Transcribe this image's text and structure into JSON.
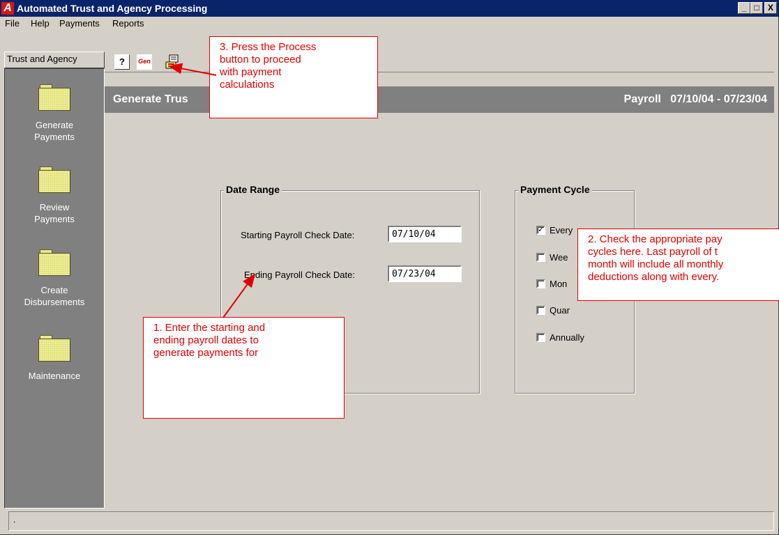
{
  "window": {
    "title": "Automated Trust and Agency Processing",
    "icon_letter": "A",
    "controls": {
      "minimize": "_",
      "maximize": "□",
      "close": "X"
    }
  },
  "menu": [
    "File",
    "Help",
    "Payments",
    "Reports"
  ],
  "sidebar": {
    "tab_label": "Trust and Agency",
    "items": [
      {
        "label_line1": "Generate",
        "label_line2": "Payments",
        "icon": "folder-icon"
      },
      {
        "label_line1": "Review",
        "label_line2": "Payments",
        "icon": "folder-icon"
      },
      {
        "label_line1": "Create",
        "label_line2": "Disbursements",
        "icon": "folder-icon"
      },
      {
        "label_line1": "Maintenance",
        "label_line2": "",
        "icon": "folder-icon"
      }
    ]
  },
  "toolbar": {
    "help_glyph": "?",
    "process_glyph": "Gen",
    "icons": [
      "help-icon",
      "process-icon",
      "report-icon"
    ]
  },
  "header": {
    "title": "Generate Trus",
    "payroll_label": "Payroll",
    "payroll_range": "07/10/04 - 07/23/04"
  },
  "date_range": {
    "title": "Date Range",
    "start_label": "Starting Payroll Check Date:",
    "start_value": "07/10/04",
    "end_label": "Ending Payroll Check Date:",
    "end_value": "07/23/04"
  },
  "payment_cycle": {
    "title": "Payment Cycle",
    "options": [
      {
        "label": "Every",
        "checked": true
      },
      {
        "label": "Wee",
        "checked": false
      },
      {
        "label": "Mon",
        "checked": false
      },
      {
        "label": "Quar",
        "checked": false
      },
      {
        "label": "Annually",
        "checked": false
      }
    ]
  },
  "callouts": {
    "c1": [
      "1. Enter the starting and",
      "ending payroll dates to",
      "generate payments for"
    ],
    "c2": [
      "2. Check the appropriate pay",
      "cycles here.  Last payroll of t",
      "month will include all monthly",
      "deductions along with every."
    ],
    "c3": [
      "3. Press the Process",
      "button to proceed",
      "with payment",
      "calculations"
    ]
  },
  "status": {
    "text": "."
  },
  "colors": {
    "titlebar": "#0a246a",
    "callout": "#e00000",
    "sidebar": "#808080",
    "face": "#d4d0c8"
  }
}
